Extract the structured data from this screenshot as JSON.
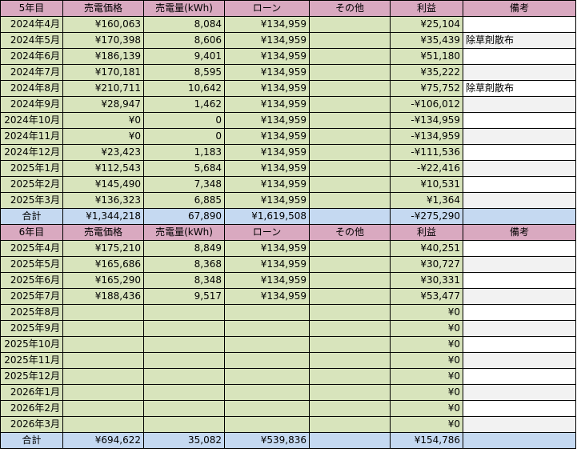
{
  "columns": [
    "売電価格",
    "売電量(kWh)",
    "ローン",
    "その他",
    "利益",
    "備考"
  ],
  "sections": [
    {
      "title": "5年目",
      "rows": [
        {
          "month": "2024年4月",
          "price": "¥160,063",
          "kwh": "8,084",
          "loan": "¥134,959",
          "other": "",
          "profit": "¥25,104",
          "note": ""
        },
        {
          "month": "2024年5月",
          "price": "¥170,398",
          "kwh": "8,606",
          "loan": "¥134,959",
          "other": "",
          "profit": "¥35,439",
          "note": "除草剤散布"
        },
        {
          "month": "2024年6月",
          "price": "¥186,139",
          "kwh": "9,401",
          "loan": "¥134,959",
          "other": "",
          "profit": "¥51,180",
          "note": ""
        },
        {
          "month": "2024年7月",
          "price": "¥170,181",
          "kwh": "8,595",
          "loan": "¥134,959",
          "other": "",
          "profit": "¥35,222",
          "note": ""
        },
        {
          "month": "2024年8月",
          "price": "¥210,711",
          "kwh": "10,642",
          "loan": "¥134,959",
          "other": "",
          "profit": "¥75,752",
          "note": "除草剤散布"
        },
        {
          "month": "2024年9月",
          "price": "¥28,947",
          "kwh": "1,462",
          "loan": "¥134,959",
          "other": "",
          "profit": "-¥106,012",
          "note": ""
        },
        {
          "month": "2024年10月",
          "price": "¥0",
          "kwh": "0",
          "loan": "¥134,959",
          "other": "",
          "profit": "-¥134,959",
          "note": ""
        },
        {
          "month": "2024年11月",
          "price": "¥0",
          "kwh": "0",
          "loan": "¥134,959",
          "other": "",
          "profit": "-¥134,959",
          "note": ""
        },
        {
          "month": "2024年12月",
          "price": "¥23,423",
          "kwh": "1,183",
          "loan": "¥134,959",
          "other": "",
          "profit": "-¥111,536",
          "note": ""
        },
        {
          "month": "2025年1月",
          "price": "¥112,543",
          "kwh": "5,684",
          "loan": "¥134,959",
          "other": "",
          "profit": "-¥22,416",
          "note": ""
        },
        {
          "month": "2025年2月",
          "price": "¥145,490",
          "kwh": "7,348",
          "loan": "¥134,959",
          "other": "",
          "profit": "¥10,531",
          "note": ""
        },
        {
          "month": "2025年3月",
          "price": "¥136,323",
          "kwh": "6,885",
          "loan": "¥134,959",
          "other": "",
          "profit": "¥1,364",
          "note": ""
        }
      ],
      "total": {
        "label": "合計",
        "price": "¥1,344,218",
        "kwh": "67,890",
        "loan": "¥1,619,508",
        "other": "",
        "profit": "-¥275,290",
        "note": ""
      }
    },
    {
      "title": "6年目",
      "rows": [
        {
          "month": "2025年4月",
          "price": "¥175,210",
          "kwh": "8,849",
          "loan": "¥134,959",
          "other": "",
          "profit": "¥40,251",
          "note": ""
        },
        {
          "month": "2025年5月",
          "price": "¥165,686",
          "kwh": "8,368",
          "loan": "¥134,959",
          "other": "",
          "profit": "¥30,727",
          "note": ""
        },
        {
          "month": "2025年6月",
          "price": "¥165,290",
          "kwh": "8,348",
          "loan": "¥134,959",
          "other": "",
          "profit": "¥30,331",
          "note": ""
        },
        {
          "month": "2025年7月",
          "price": "¥188,436",
          "kwh": "9,517",
          "loan": "¥134,959",
          "other": "",
          "profit": "¥53,477",
          "note": ""
        },
        {
          "month": "2025年8月",
          "price": "",
          "kwh": "",
          "loan": "",
          "other": "",
          "profit": "¥0",
          "note": ""
        },
        {
          "month": "2025年9月",
          "price": "",
          "kwh": "",
          "loan": "",
          "other": "",
          "profit": "¥0",
          "note": ""
        },
        {
          "month": "2025年10月",
          "price": "",
          "kwh": "",
          "loan": "",
          "other": "",
          "profit": "¥0",
          "note": ""
        },
        {
          "month": "2025年11月",
          "price": "",
          "kwh": "",
          "loan": "",
          "other": "",
          "profit": "¥0",
          "note": ""
        },
        {
          "month": "2025年12月",
          "price": "",
          "kwh": "",
          "loan": "",
          "other": "",
          "profit": "¥0",
          "note": ""
        },
        {
          "month": "2026年1月",
          "price": "",
          "kwh": "",
          "loan": "",
          "other": "",
          "profit": "¥0",
          "note": ""
        },
        {
          "month": "2026年2月",
          "price": "",
          "kwh": "",
          "loan": "",
          "other": "",
          "profit": "¥0",
          "note": ""
        },
        {
          "month": "2026年3月",
          "price": "",
          "kwh": "",
          "loan": "",
          "other": "",
          "profit": "¥0",
          "note": ""
        }
      ],
      "total": {
        "label": "合計",
        "price": "¥694,622",
        "kwh": "35,082",
        "loan": "¥539,836",
        "other": "",
        "profit": "¥154,786",
        "note": ""
      }
    }
  ],
  "colors": {
    "header": "#d9a9c0",
    "row": "#d8e4bc",
    "total": "#c5d9f1",
    "note_white": "#ffffff",
    "note_gray": "#f2f2f2"
  }
}
